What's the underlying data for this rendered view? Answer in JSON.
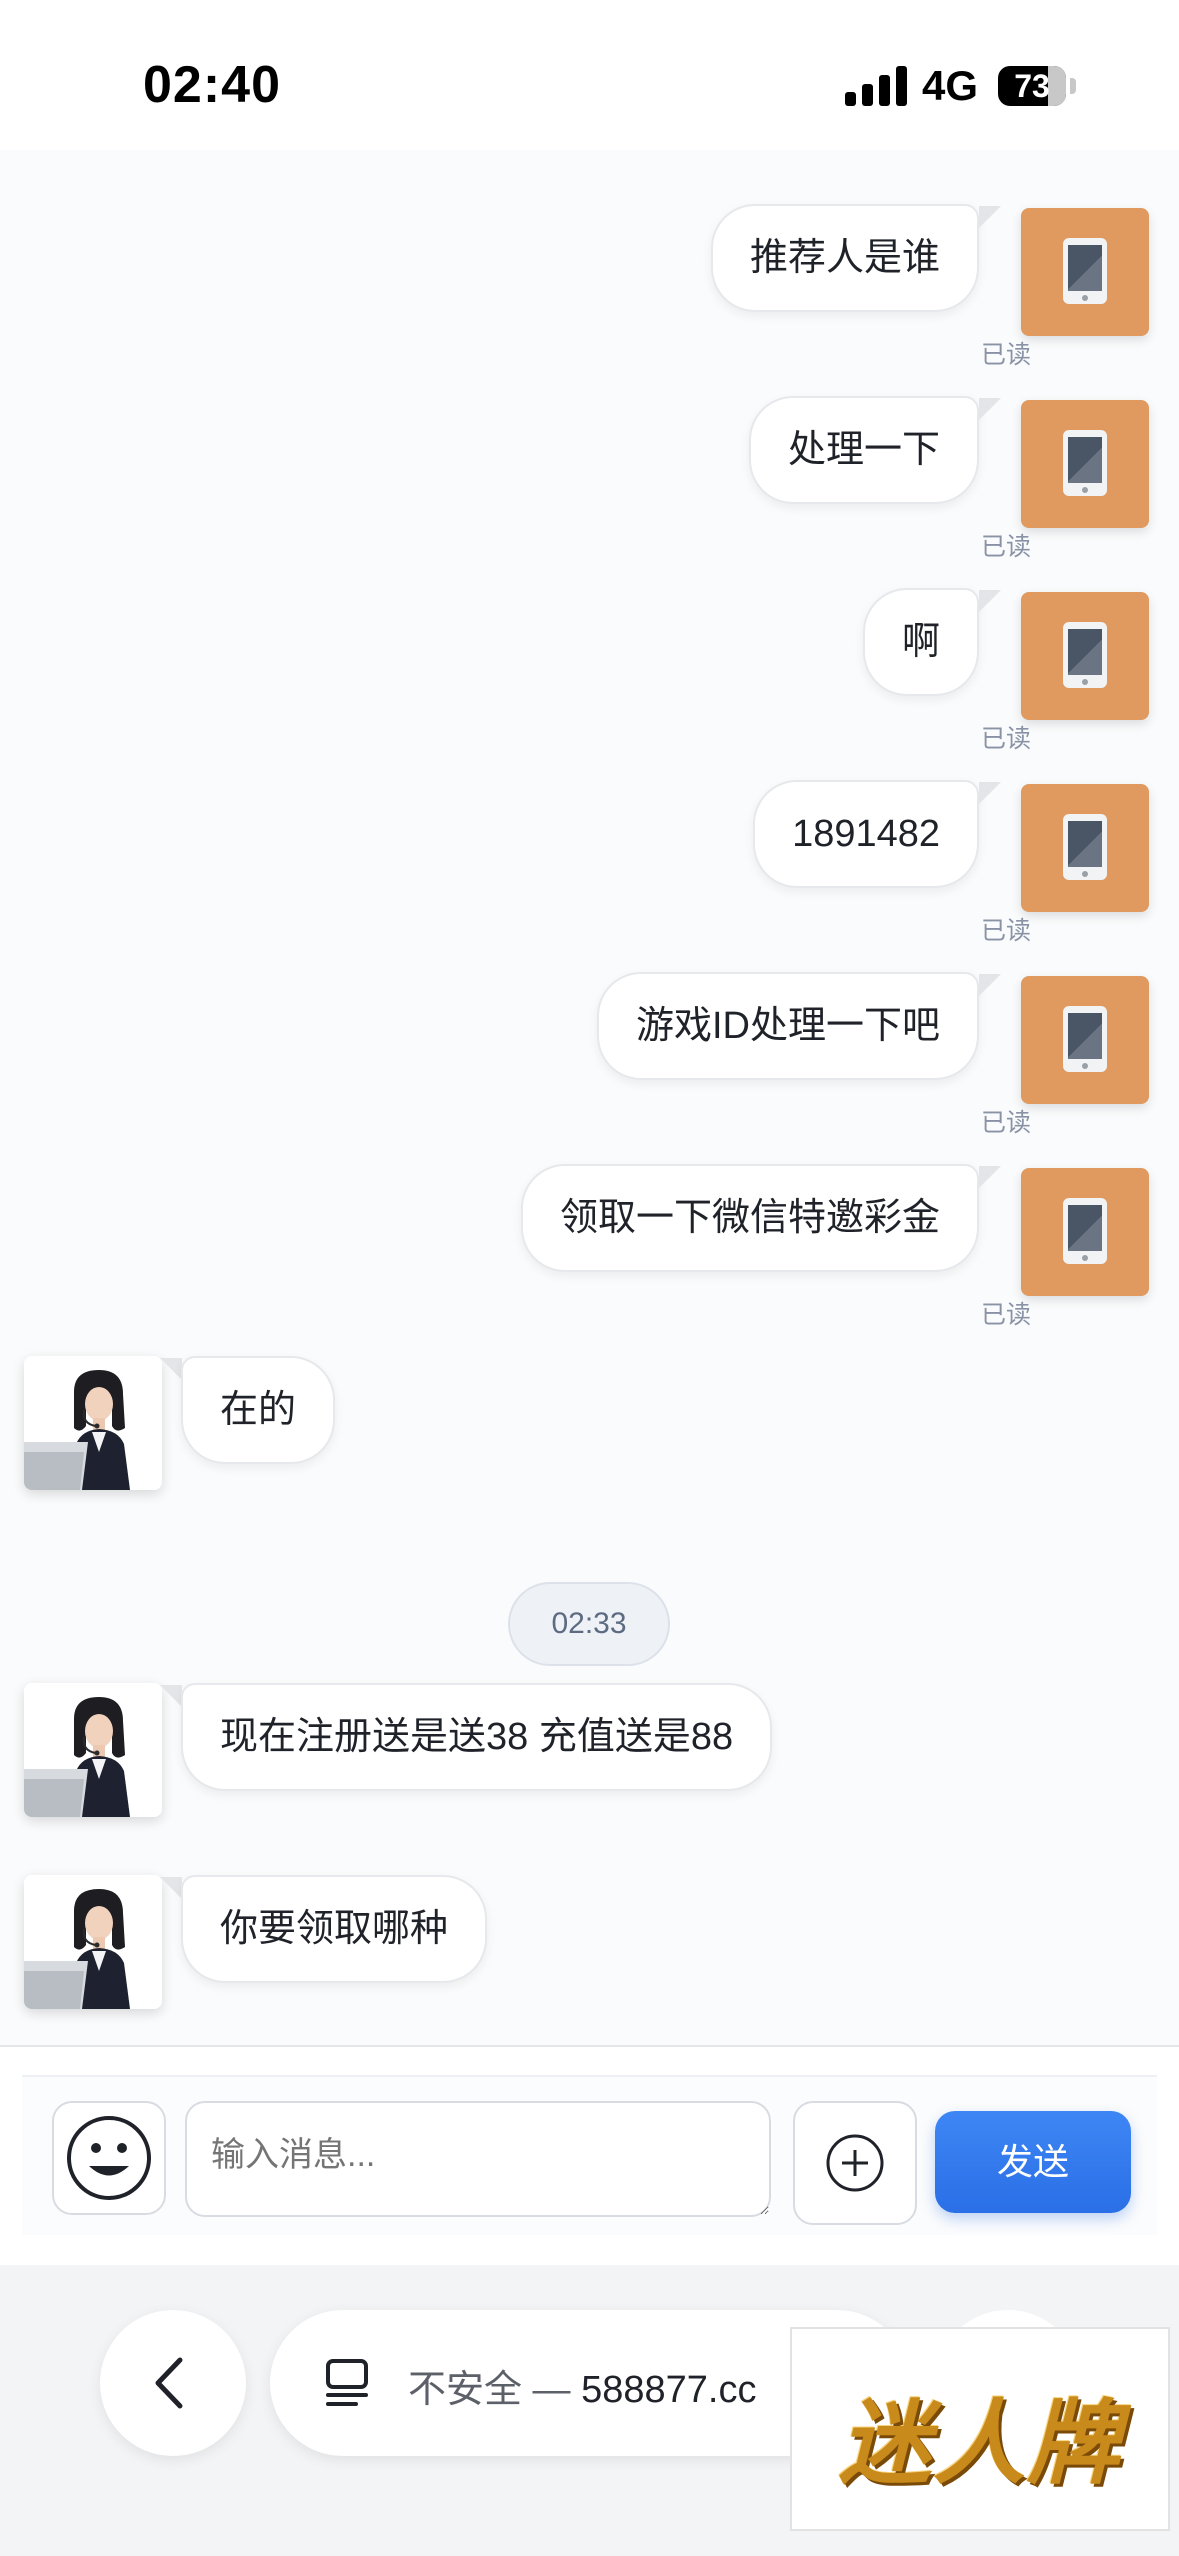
{
  "status_bar": {
    "time": "02:40",
    "network": "4G",
    "battery": "73",
    "battery_level": 0.73
  },
  "messages": [
    {
      "side": "right",
      "text": "推荐人是谁",
      "read": "已读"
    },
    {
      "side": "right",
      "text": "处理一下",
      "read": "已读"
    },
    {
      "side": "right",
      "text": "啊",
      "read": "已读"
    },
    {
      "side": "right",
      "text": "1891482",
      "read": "已读"
    },
    {
      "side": "right",
      "text": "游戏ID处理一下吧",
      "read": "已读"
    },
    {
      "side": "right",
      "text": "领取一下微信特邀彩金",
      "read": "已读"
    },
    {
      "side": "left",
      "text": "在的"
    },
    {
      "side": "left",
      "text": "现在注册送是送38 充值送是88"
    },
    {
      "side": "left",
      "text": "你要领取哪种"
    }
  ],
  "time_divider": "02:33",
  "composer": {
    "placeholder": "输入消息...",
    "send_label": "发送"
  },
  "browser": {
    "insecure_label": "不安全 — ",
    "domain": "588877.cc"
  },
  "watermark": {
    "text": "迷人牌"
  },
  "colors": {
    "user_avatar": "#e0995e",
    "send_button": "#2f76ee",
    "read_receipt": "#8a93a6"
  }
}
